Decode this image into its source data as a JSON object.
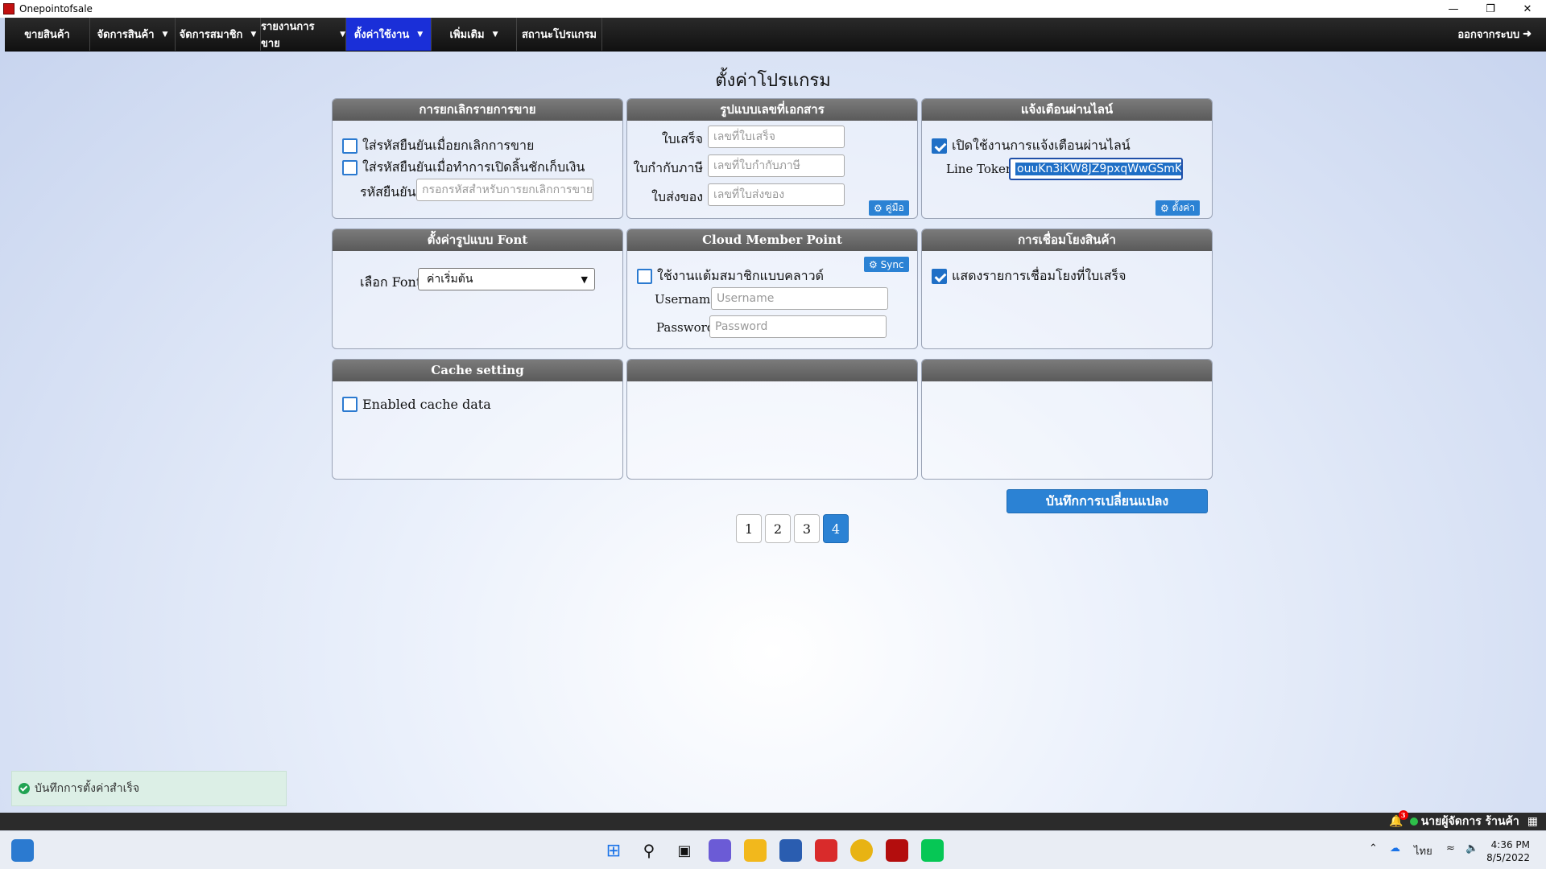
{
  "window": {
    "title": "Onepointofsale"
  },
  "nav": {
    "items": [
      {
        "label": "ขายสินค้า",
        "caret": false
      },
      {
        "label": "จัดการสินค้า",
        "caret": true
      },
      {
        "label": "จัดการสมาชิก",
        "caret": true
      },
      {
        "label": "รายงานการขาย",
        "caret": true
      },
      {
        "label": "ตั้งค่าใช้งาน",
        "caret": true,
        "active": true
      },
      {
        "label": "เพิ่มเติม",
        "caret": true
      },
      {
        "label": "สถานะโปรแกรม",
        "caret": false
      }
    ],
    "logout_label": "ออกจากระบบ"
  },
  "page_title": "ตั้งค่าโปรแกรม",
  "panels": {
    "cancel_sale": {
      "title": "การยกเลิกรายการขาย",
      "opt1": "ใส่รหัสยืนยันเมื่อยกเลิกการขาย",
      "opt2": "ใส่รหัสยืนยันเมื่อทำการเปิดลิ้นชักเก็บเงิน",
      "code_label": "รหัสยืนยัน",
      "code_placeholder": "กรอกรหัสสำหรับการยกเลิกการขาย"
    },
    "doc_format": {
      "title": "รูปแบบเลขที่เอกสาร",
      "receipt_label": "ใบเสร็จ",
      "receipt_placeholder": "เลขที่ใบเสร็จ",
      "tax_label": "ใบกำกับภาษี",
      "tax_placeholder": "เลขที่ใบกำกับภาษี",
      "delivery_label": "ใบส่งของ",
      "delivery_placeholder": "เลขที่ใบส่งของ",
      "manual_btn": "คู่มือ"
    },
    "line_notify": {
      "title": "แจ้งเตือนผ่านไลน์",
      "enable_label": "เปิดใช้งานการแจ้งเตือนผ่านไลน์",
      "token_label": "Line Token",
      "token_value": "ouuKn3iKW8JZ9pxqWwGSmK",
      "settings_btn": "ตั้งค่า"
    },
    "font": {
      "title": "ตั้งค่ารูปแบบ Font",
      "select_label": "เลือก Font",
      "selected": "ค่าเริ่มต้น"
    },
    "cloud": {
      "title": "Cloud Member Point",
      "sync_btn": "Sync",
      "enable_label": "ใช้งานแต้มสมาชิกแบบคลาวด์",
      "username_label": "Username",
      "username_placeholder": "Username",
      "password_label": "Password",
      "password_placeholder": "Password"
    },
    "product_link": {
      "title": "การเชื่อมโยงสินค้า",
      "show_label": "แสดงรายการเชื่อมโยงที่ใบเสร็จ"
    },
    "cache": {
      "title": "Cache setting",
      "enable_label": "Enabled cache data"
    }
  },
  "save_label": "บันทึกการเปลี่ยนแปลง",
  "pagination": [
    "1",
    "2",
    "3",
    "4"
  ],
  "toast": "บันทึกการตั้งค่าสำเร็จ",
  "statusbar": {
    "notif_count": "3",
    "user": "นายผู้จัดการ ร้านค้า"
  },
  "taskbar": {
    "lang": "ไทย",
    "time": "4:36 PM",
    "date": "8/5/2022"
  }
}
